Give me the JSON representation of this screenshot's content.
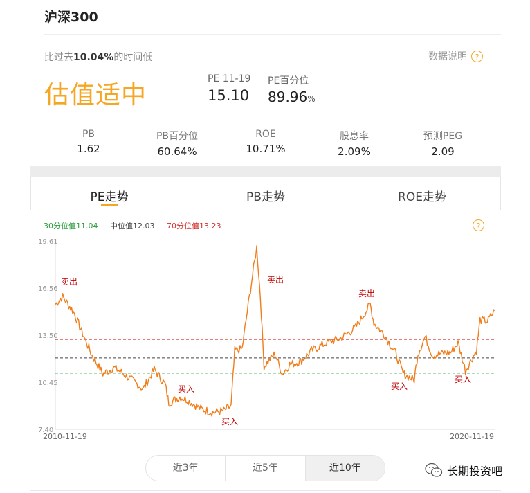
{
  "header": {
    "title": "沪深300"
  },
  "summary": {
    "compare_prefix": "比过去",
    "compare_pct": "10.04%",
    "compare_suffix": "的时间低",
    "explain_label": "数据说明",
    "help_icon": "?",
    "level": "估值适中",
    "pe_label": "PE 11-19",
    "pe_value": "15.10",
    "pe_pct_label": "PE百分位",
    "pe_pct_value": "89.96",
    "pe_pct_unit": "%"
  },
  "metrics": [
    {
      "label": "PB",
      "value": "1.62"
    },
    {
      "label": "PB百分位",
      "value": "60.64%"
    },
    {
      "label": "ROE",
      "value": "10.71%"
    },
    {
      "label": "股息率",
      "value": "2.09%"
    },
    {
      "label": "预测PEG",
      "value": "2.09"
    }
  ],
  "tabs": [
    {
      "label": "PE走势",
      "active": true
    },
    {
      "label": "PB走势",
      "active": false
    },
    {
      "label": "ROE走势",
      "active": false
    }
  ],
  "legend": {
    "p30": "30分位值11.04",
    "median": "中位值12.03",
    "p70": "70分位值13.23"
  },
  "colors": {
    "accent": "#f5a623",
    "line": "#f07d1a",
    "p30": "#2a9d3a",
    "median": "#444444",
    "p70": "#d0312d",
    "signal": "#c00000"
  },
  "range_buttons": [
    "近3年",
    "近5年",
    "近10年"
  ],
  "selected_range": "近10年",
  "watermark": "长期投资吧",
  "chart_data": {
    "type": "line",
    "title": "",
    "xlabel": "",
    "ylabel": "",
    "x_tick_labels": [
      "2010-11-19",
      "2020-11-19"
    ],
    "y_tick_labels": [
      "19.61",
      "16.56",
      "13.50",
      "10.45",
      "7.40"
    ],
    "ylim": [
      7.4,
      19.61
    ],
    "reference_lines": [
      {
        "label": "30分位值",
        "value": 11.04
      },
      {
        "label": "中位值",
        "value": 12.03
      },
      {
        "label": "70分位值",
        "value": 13.23
      }
    ],
    "series": [
      {
        "x": [
          "2010-11",
          "2011-01",
          "2011-04",
          "2011-07",
          "2011-09",
          "2011-12",
          "2012-03",
          "2012-05",
          "2012-09",
          "2012-11",
          "2013-02",
          "2013-05",
          "2013-06",
          "2013-09",
          "2013-11",
          "2014-03",
          "2014-06",
          "2014-09",
          "2014-11",
          "2014-12",
          "2015-02",
          "2015-04",
          "2015-06",
          "2015-07",
          "2015-08",
          "2015-11",
          "2016-01",
          "2016-03",
          "2016-06",
          "2016-09",
          "2017-01",
          "2017-05",
          "2017-09",
          "2018-01",
          "2018-02",
          "2018-05",
          "2018-08",
          "2018-10",
          "2019-01",
          "2019-02",
          "2019-04",
          "2019-06",
          "2019-08",
          "2019-11",
          "2020-01",
          "2020-03",
          "2020-06",
          "2020-07",
          "2020-09",
          "2020-11"
        ],
        "y": [
          15.5,
          16.0,
          15.0,
          13.3,
          12.2,
          11.0,
          11.4,
          11.1,
          10.4,
          10.0,
          11.3,
          10.3,
          9.1,
          9.5,
          9.3,
          8.7,
          8.5,
          8.6,
          8.9,
          12.5,
          12.6,
          16.0,
          19.2,
          16.0,
          11.5,
          12.3,
          11.0,
          11.6,
          11.8,
          12.5,
          13.0,
          13.3,
          14.0,
          15.5,
          14.3,
          13.5,
          12.3,
          11.0,
          10.6,
          12.3,
          13.4,
          12.2,
          12.3,
          12.4,
          13.0,
          11.2,
          12.5,
          14.5,
          14.4,
          15.1
        ]
      }
    ],
    "annotations": [
      "卖出",
      "买入",
      "买入",
      "卖出",
      "卖出",
      "买入",
      "买入"
    ]
  }
}
